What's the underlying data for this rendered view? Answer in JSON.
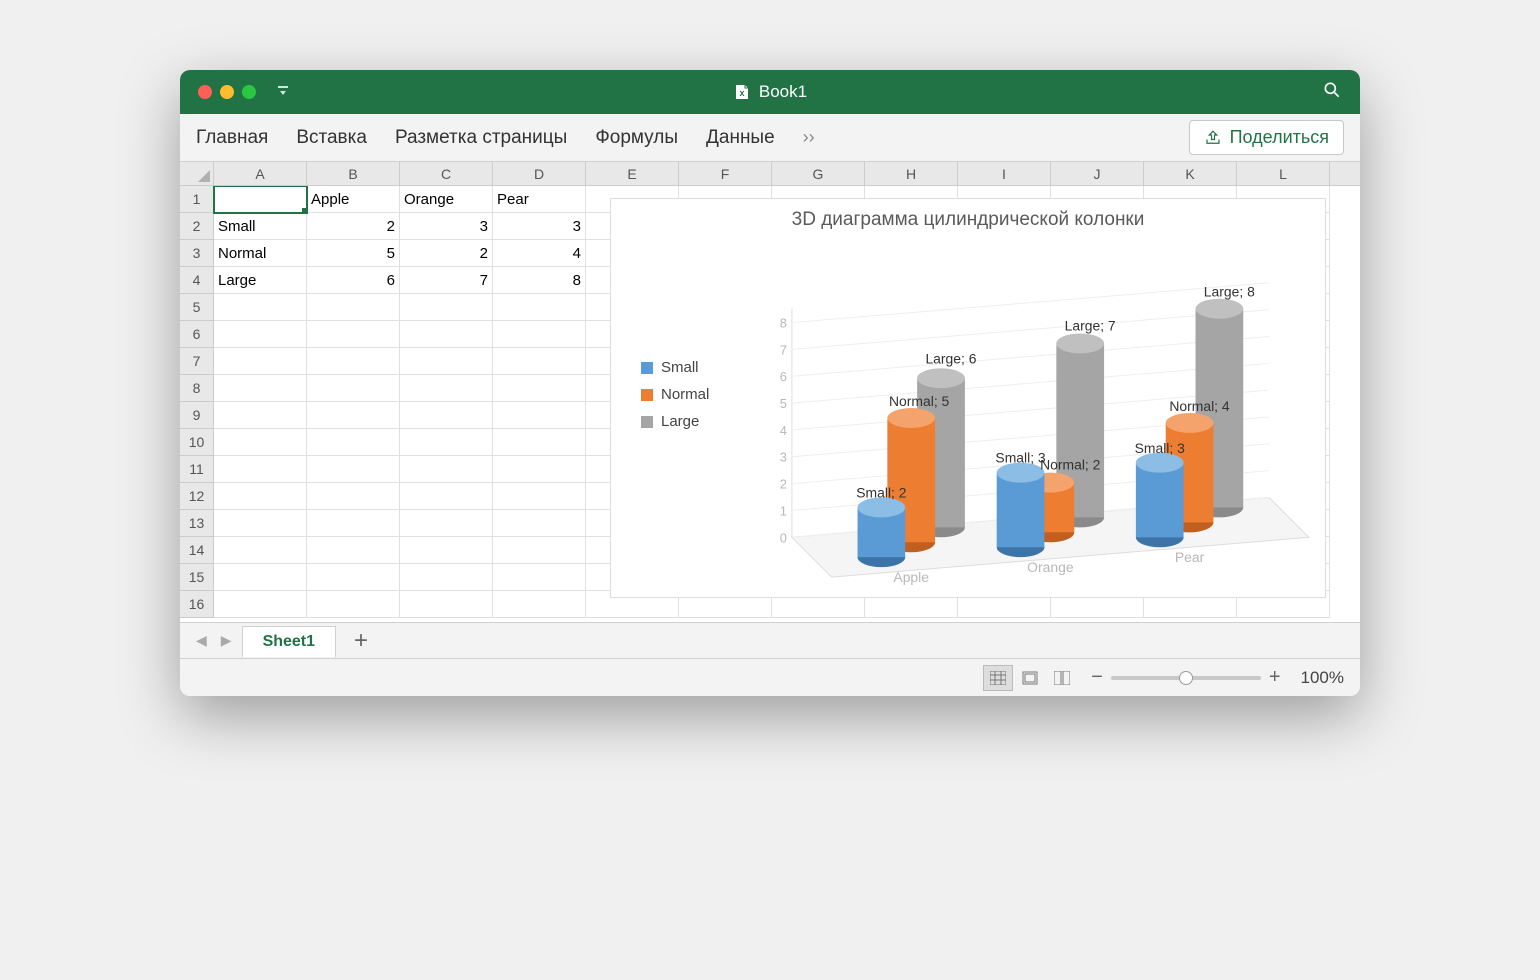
{
  "title": "Book1",
  "ribbon": {
    "tabs": [
      "Главная",
      "Вставка",
      "Разметка страницы",
      "Формулы",
      "Данные"
    ],
    "share": "Поделиться"
  },
  "columns": [
    "A",
    "B",
    "C",
    "D",
    "E",
    "F",
    "G",
    "H",
    "I",
    "J",
    "K",
    "L"
  ],
  "rows": [
    "1",
    "2",
    "3",
    "4",
    "5",
    "6",
    "7",
    "8",
    "9",
    "10",
    "11",
    "12",
    "13",
    "14",
    "15",
    "16"
  ],
  "cells": {
    "B1": "Apple",
    "C1": "Orange",
    "D1": "Pear",
    "A2": "Small",
    "B2": "2",
    "C2": "3",
    "D2": "3",
    "A3": "Normal",
    "B3": "5",
    "C3": "2",
    "D3": "4",
    "A4": "Large",
    "B4": "6",
    "C4": "7",
    "D4": "8"
  },
  "selected_cell": "A1",
  "chart": {
    "title": "3D диаграмма цилиндрической колонки",
    "legend": {
      "small": "Small",
      "normal": "Normal",
      "large": "Large"
    },
    "yticks": [
      "0",
      "1",
      "2",
      "3",
      "4",
      "5",
      "6",
      "7",
      "8"
    ],
    "xcats": [
      "Apple",
      "Orange",
      "Pear"
    ],
    "labels": {
      "s_apple": "Small; 2",
      "n_apple": "Normal; 5",
      "l_apple": "Large; 6",
      "s_orange": "Small; 3",
      "n_orange": "Normal; 2",
      "l_orange": "Large; 7",
      "s_pear": "Small; 3",
      "n_pear": "Normal; 4",
      "l_pear": "Large; 8"
    }
  },
  "chart_data": {
    "type": "bar",
    "title": "3D диаграмма цилиндрической колонки",
    "categories": [
      "Apple",
      "Orange",
      "Pear"
    ],
    "series": [
      {
        "name": "Small",
        "values": [
          2,
          3,
          3
        ]
      },
      {
        "name": "Normal",
        "values": [
          5,
          2,
          4
        ]
      },
      {
        "name": "Large",
        "values": [
          6,
          7,
          8
        ]
      }
    ],
    "ylim": [
      0,
      8
    ],
    "xlabel": "",
    "ylabel": ""
  },
  "sheet": {
    "name": "Sheet1"
  },
  "status": {
    "zoom": "100%"
  }
}
